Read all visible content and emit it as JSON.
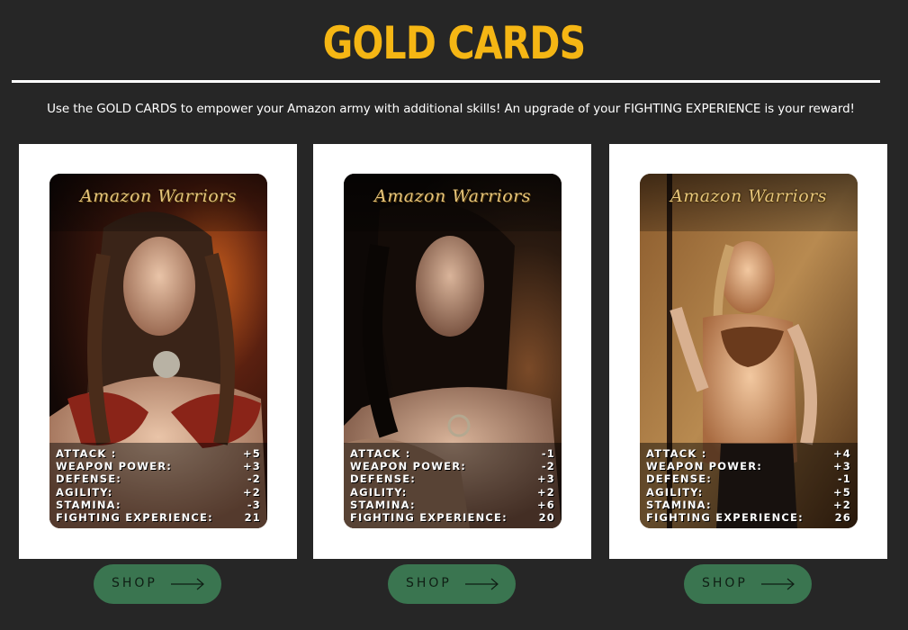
{
  "header": {
    "title": "GOLD CARDS",
    "subtitle": "Use the GOLD CARDS to empower your Amazon army with additional skills! An upgrade of your FIGHTING EXPERIENCE is your reward!"
  },
  "cards": [
    {
      "logo": "Amazon Warriors",
      "stats": [
        {
          "label": "ATTACK :",
          "value": "+5"
        },
        {
          "label": "WEAPON POWER:",
          "value": "+3"
        },
        {
          "label": "DEFENSE:",
          "value": "-2"
        },
        {
          "label": "AGILITY:",
          "value": "+2"
        },
        {
          "label": "STAMINA:",
          "value": "-3"
        },
        {
          "label": "FIGHTING EXPERIENCE:",
          "value": "21"
        }
      ],
      "shop_label": "SHOP"
    },
    {
      "logo": "Amazon Warriors",
      "stats": [
        {
          "label": "ATTACK :",
          "value": "-1"
        },
        {
          "label": "WEAPON POWER:",
          "value": "-2"
        },
        {
          "label": "DEFENSE:",
          "value": "+3"
        },
        {
          "label": "AGILITY:",
          "value": "+2"
        },
        {
          "label": "STAMINA:",
          "value": "+6"
        },
        {
          "label": "FIGHTING EXPERIENCE:",
          "value": "20"
        }
      ],
      "shop_label": "SHOP"
    },
    {
      "logo": "Amazon Warriors",
      "stats": [
        {
          "label": "ATTACK :",
          "value": "+4"
        },
        {
          "label": "WEAPON POWER:",
          "value": "+3"
        },
        {
          "label": "DEFENSE:",
          "value": "-1"
        },
        {
          "label": "AGILITY:",
          "value": "+5"
        },
        {
          "label": "STAMINA:",
          "value": "+2"
        },
        {
          "label": "FIGHTING EXPERIENCE:",
          "value": "26"
        }
      ],
      "shop_label": "SHOP"
    }
  ],
  "icons": {
    "shop_arrow": "arrow-right-icon",
    "logo_emblem": "archer-emblem-icon"
  },
  "colors": {
    "background": "#262626",
    "title": "#f5b614",
    "shop_button": "#3a7550",
    "panel": "#ffffff"
  }
}
